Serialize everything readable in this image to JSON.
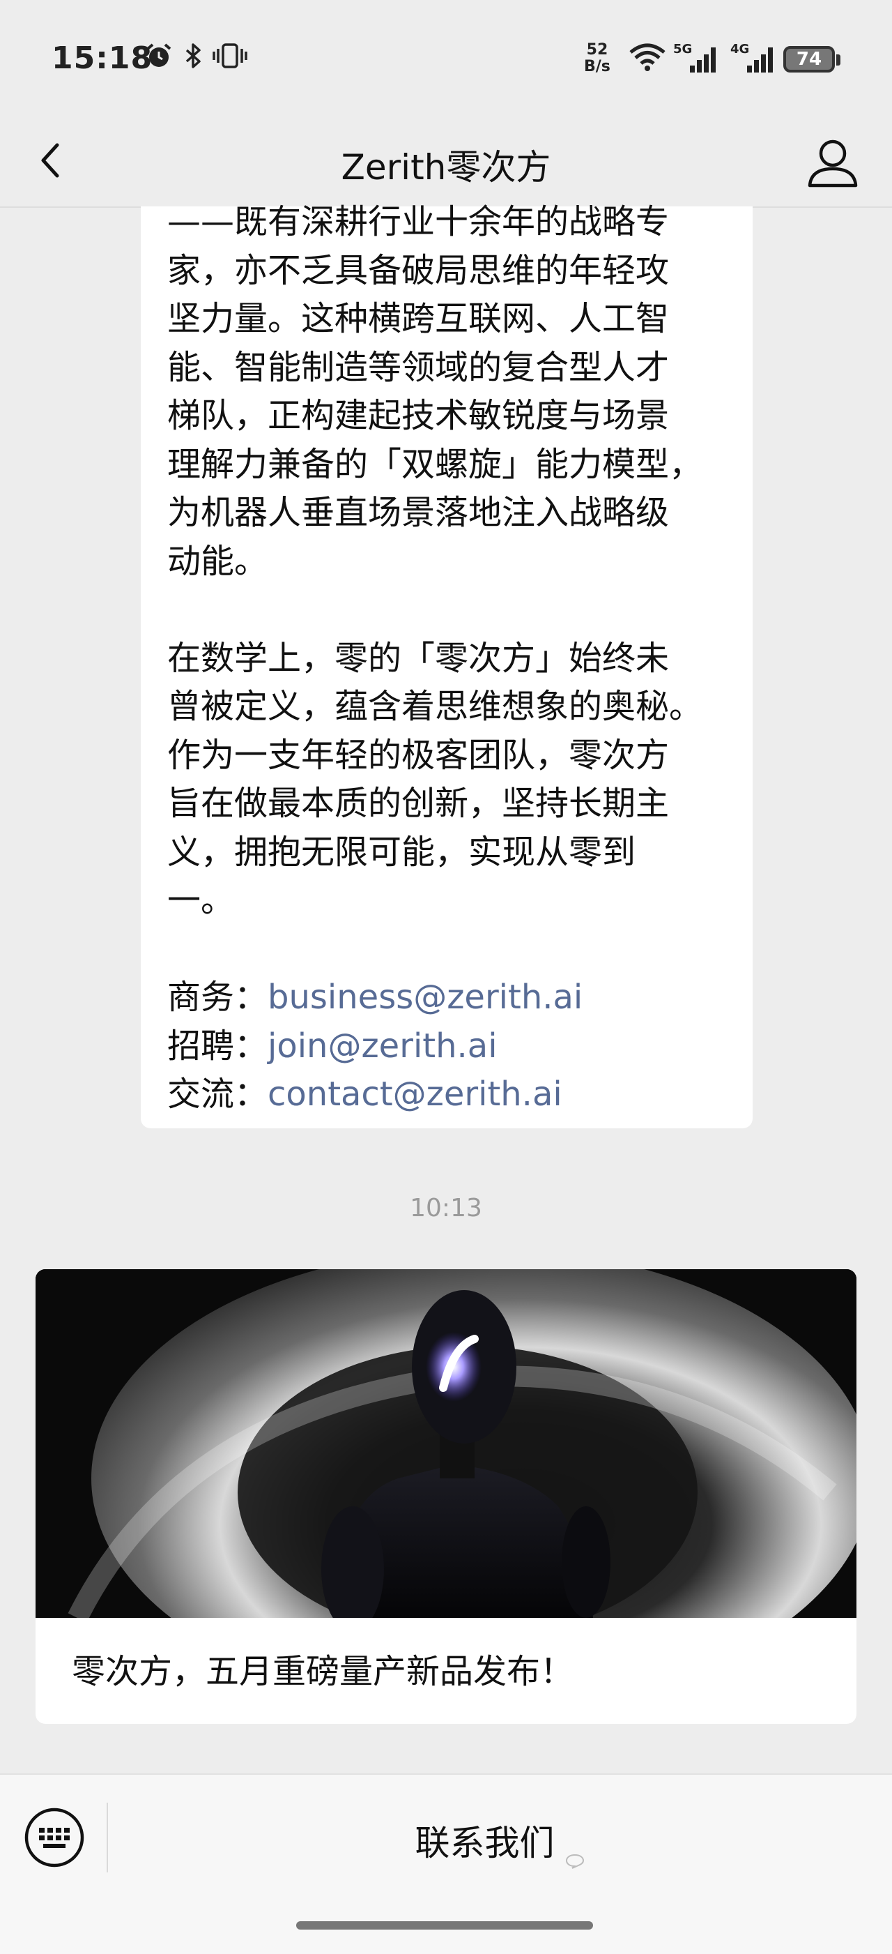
{
  "status_bar": {
    "time": "15:18",
    "net_speed_value": "52",
    "net_speed_unit": "B/s",
    "signal_1_label": "5G",
    "signal_2_label": "4G",
    "battery": "74",
    "icons": [
      "alarm-icon",
      "bluetooth-icon",
      "vibrate-icon",
      "wifi-icon",
      "signal-icon",
      "battery-icon"
    ]
  },
  "header": {
    "title": "Zerith零次方",
    "back_icon": "chevron-left-icon",
    "profile_icon": "person-icon"
  },
  "article": {
    "paragraph_1_lines": [
      "——既有深耕行业十余年的战略专",
      "家，亦不乏具备破局思维的年轻攻",
      "坚力量。这种横跨互联网、人工智",
      "能、智能制造等领域的复合型人才",
      "梯队，正构建起技术敏锐度与场景",
      "理解力兼备的「双螺旋」能力模型，",
      "为机器人垂直场景落地注入战略级",
      "动能。"
    ],
    "paragraph_2_lines": [
      "在数学上，零的「零次方」始终未",
      "曾被定义，蕴含着思维想象的奥秘。",
      "作为一支年轻的极客团队，零次方",
      "旨在做最本质的创新，坚持长期主",
      "义，拥抱无限可能，实现从零到",
      "一。"
    ],
    "contacts": [
      {
        "label": "商务：",
        "email": "business@zerith.ai"
      },
      {
        "label": "招聘：",
        "email": "join@zerith.ai"
      },
      {
        "label": "交流：",
        "email": "contact@zerith.ai"
      }
    ]
  },
  "timestamp": "10:13",
  "card": {
    "title": "零次方，五月重磅量产新品发布！",
    "image": "robot-figure-image"
  },
  "bottom_bar": {
    "keyboard_icon": "keyboard-icon",
    "menu_label": "联系我们",
    "menu_icon": "chat-bubble-icon"
  }
}
